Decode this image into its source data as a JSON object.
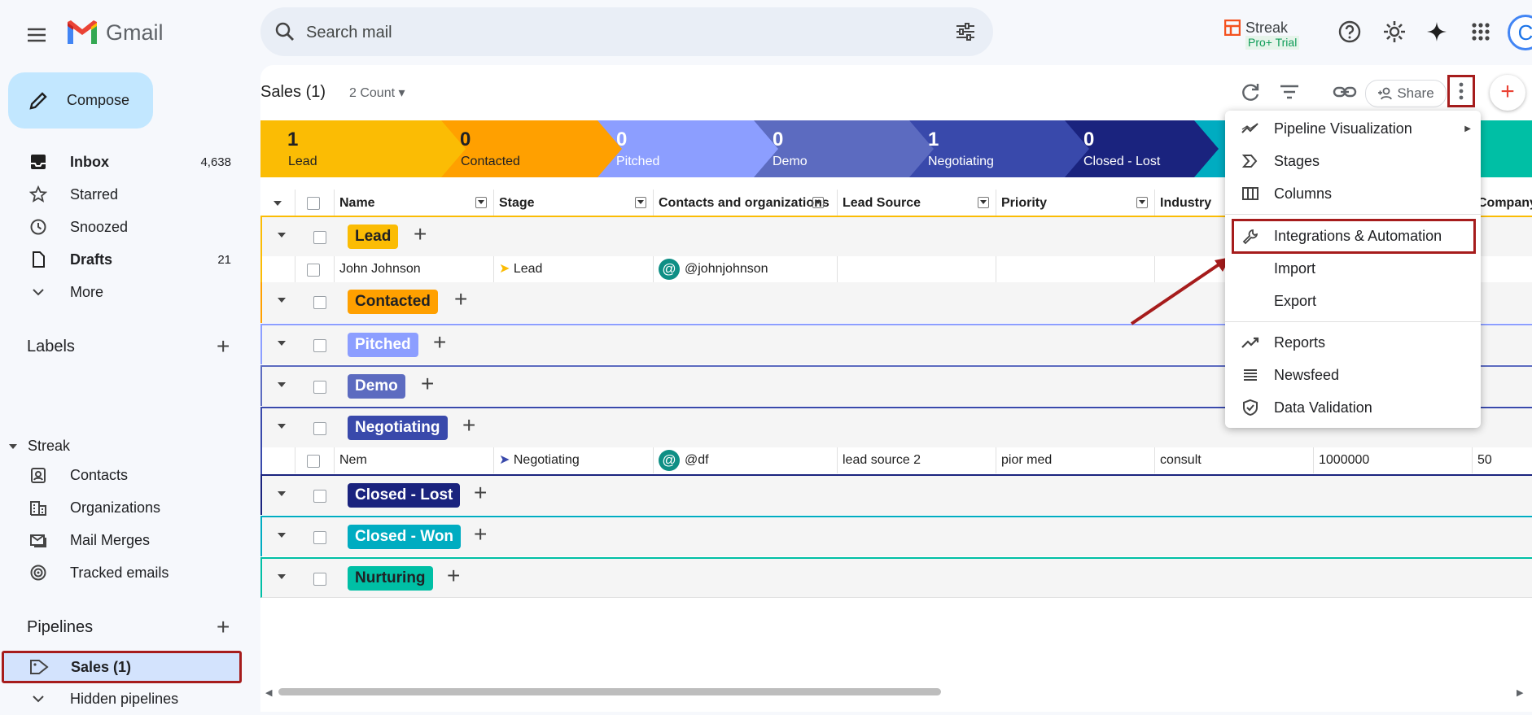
{
  "app": {
    "name": "Gmail"
  },
  "search": {
    "placeholder": "Search mail"
  },
  "streak": {
    "name": "Streak",
    "trial": "Pro+ Trial"
  },
  "avatar": {
    "initial": "C"
  },
  "compose": {
    "label": "Compose"
  },
  "nav": [
    {
      "label": "Inbox",
      "count": "4,638",
      "bold": true,
      "icon": "inbox-icon"
    },
    {
      "label": "Starred",
      "count": "",
      "icon": "star-icon"
    },
    {
      "label": "Snoozed",
      "count": "",
      "icon": "clock-icon"
    },
    {
      "label": "Drafts",
      "count": "21",
      "bold": true,
      "icon": "draft-icon"
    },
    {
      "label": "More",
      "count": "",
      "icon": "chevron-down-icon"
    }
  ],
  "labels_heading": "Labels",
  "streak_section": {
    "title": "Streak",
    "items": [
      {
        "label": "Contacts",
        "icon": "contact-card-icon"
      },
      {
        "label": "Organizations",
        "icon": "building-icon"
      },
      {
        "label": "Mail Merges",
        "icon": "mail-merge-icon"
      },
      {
        "label": "Tracked emails",
        "icon": "tracked-icon"
      }
    ]
  },
  "pipelines": {
    "title": "Pipelines",
    "items": [
      {
        "label": "Sales (1)",
        "icon": "tag-icon"
      },
      {
        "label": "Hidden pipelines",
        "icon": "chevron-down-icon"
      }
    ]
  },
  "toolbar": {
    "title": "Sales (1)",
    "count_label": "2 Count",
    "share_label": "Share"
  },
  "stages": [
    {
      "count": "1",
      "label": "Lead",
      "color": "#fbbc04"
    },
    {
      "count": "0",
      "label": "Contacted",
      "color": "#ffa000"
    },
    {
      "count": "0",
      "label": "Pitched",
      "color": "#8c9eff"
    },
    {
      "count": "0",
      "label": "Demo",
      "color": "#5c6bc0"
    },
    {
      "count": "1",
      "label": "Negotiating",
      "color": "#3949ab"
    },
    {
      "count": "0",
      "label": "Closed - Lost",
      "color": "#1a237e"
    },
    {
      "count": "",
      "label": "",
      "color": "#00acc1"
    },
    {
      "count": "",
      "label": "",
      "color": "#00bfa5"
    }
  ],
  "columns": [
    "Name",
    "Stage",
    "Contacts and organizations",
    "Lead Source",
    "Priority",
    "Industry",
    "",
    "Company"
  ],
  "groups": [
    {
      "name": "Lead",
      "color": "#fbbc04",
      "text_color": "#202124"
    },
    {
      "name": "Contacted",
      "color": "#ffa000",
      "text_color": "#202124"
    },
    {
      "name": "Pitched",
      "color": "#8c9eff",
      "text_color": "#ffffff"
    },
    {
      "name": "Demo",
      "color": "#5c6bc0",
      "text_color": "#ffffff"
    },
    {
      "name": "Negotiating",
      "color": "#3949ab",
      "text_color": "#ffffff"
    },
    {
      "name": "Closed - Lost",
      "color": "#1a237e",
      "text_color": "#ffffff"
    },
    {
      "name": "Closed - Won",
      "color": "#00acc1",
      "text_color": "#ffffff"
    },
    {
      "name": "Nurturing",
      "color": "#00bfa5",
      "text_color": "#202124"
    }
  ],
  "rows": [
    {
      "name": "John Johnson",
      "stage": "Lead",
      "contact": "@johnjohnson",
      "lead_source": "",
      "priority": "",
      "industry": "",
      "value": "",
      "extra": ""
    },
    {
      "name": "Nem",
      "stage": "Negotiating",
      "contact": "@df",
      "lead_source": "lead source 2",
      "priority": "pior med",
      "industry": "consult",
      "value": "1000000",
      "extra": "50"
    }
  ],
  "menu": {
    "items": [
      {
        "label": "Pipeline Visualization",
        "icon": "chart-icon",
        "submenu": true
      },
      {
        "label": "Stages",
        "icon": "stages-icon"
      },
      {
        "label": "Columns",
        "icon": "columns-icon"
      },
      {
        "label": "Integrations & Automation",
        "icon": "wrench-icon"
      },
      {
        "label": "Import",
        "icon": ""
      },
      {
        "label": "Export",
        "icon": ""
      },
      {
        "label": "Reports",
        "icon": "trend-icon"
      },
      {
        "label": "Newsfeed",
        "icon": "list-icon"
      },
      {
        "label": "Data Validation",
        "icon": "shield-check-icon"
      }
    ]
  },
  "annotation_color": "#a61c1c"
}
